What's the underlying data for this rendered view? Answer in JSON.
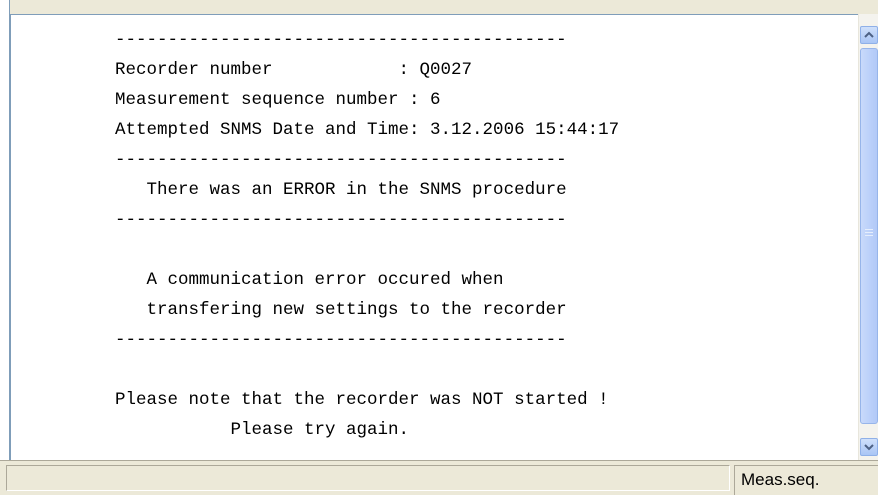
{
  "log": {
    "lines": [
      "-------------------------------------------",
      "Recorder number            : Q0027",
      "Measurement sequence number : 6",
      "Attempted SNMS Date and Time: 3.12.2006 15:44:17",
      "-------------------------------------------",
      "   There was an ERROR in the SNMS procedure",
      "-------------------------------------------",
      "",
      "   A communication error occured when",
      "   transfering new settings to the recorder",
      "-------------------------------------------",
      "",
      "Please note that the recorder was NOT started !",
      "           Please try again."
    ]
  },
  "statusbar": {
    "left": "",
    "right": "Meas.seq."
  },
  "icons": {
    "scroll_up": "chevron-up-icon",
    "scroll_down": "chevron-down-icon"
  }
}
